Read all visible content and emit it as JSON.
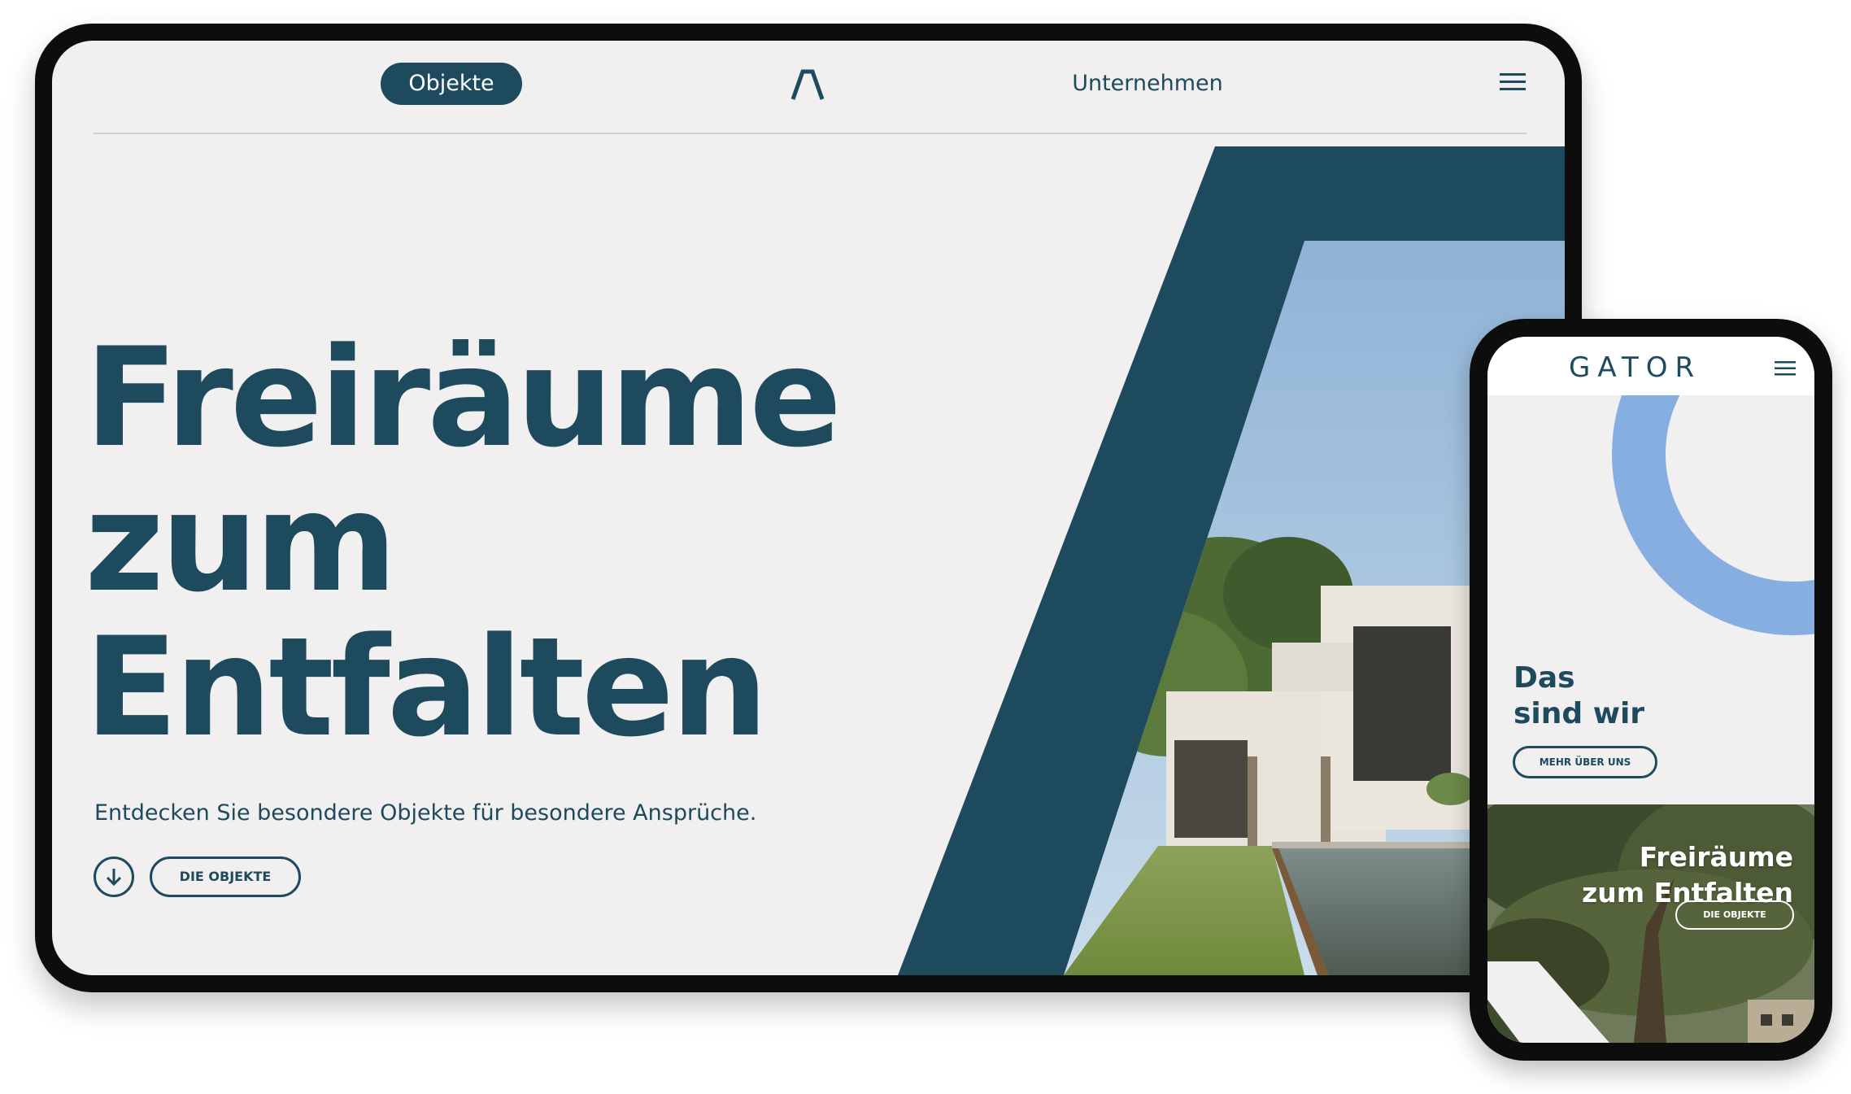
{
  "tablet": {
    "nav": {
      "objects_label": "Objekte",
      "company_label": "Unternehmen"
    },
    "hero": {
      "line1": "Freiräume",
      "line2": "zum",
      "line3": "Entfalten",
      "subtitle": "Entdecken Sie besondere Objekte für besondere Ansprüche.",
      "cta_label": "DIE OBJEKTE"
    }
  },
  "phone": {
    "logo_text": "GATOR",
    "section_title_line1": "Das",
    "section_title_line2": "sind wir",
    "about_button_label": "MEHR ÜBER UNS",
    "hero_line1": "Freiräume",
    "hero_line2": "zum Entfalten",
    "hero_cta_label": "DIE OBJEKTE"
  },
  "colors": {
    "brand_dark": "#1e4a5e",
    "background": "#f1eff0",
    "accent_light_blue": "#86aee0",
    "white": "#ffffff"
  },
  "icons": {
    "logo": "lambda-logo-icon",
    "menu": "hamburger-menu-icon",
    "scroll": "arrow-down-circle-icon"
  }
}
